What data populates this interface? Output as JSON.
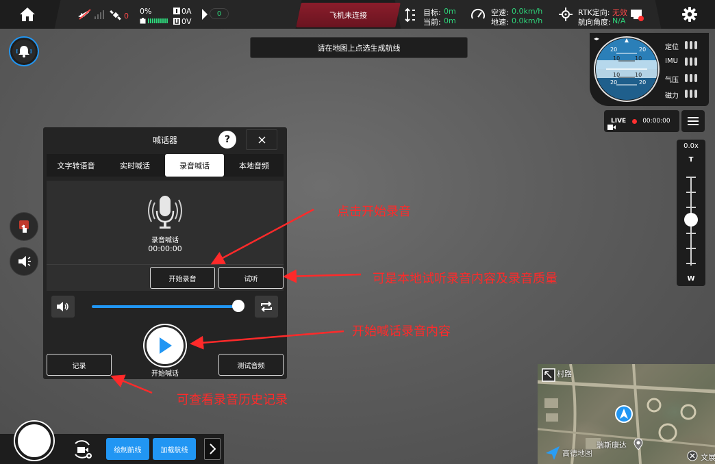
{
  "topbar": {
    "satellite_count": "0",
    "battery_percent": "0%",
    "current_a": "0A",
    "voltage_v": "0V",
    "gear_value": "0",
    "connection_status": "飞机未连接",
    "target_label": "目标:",
    "target_value": "0m",
    "current_label": "当前:",
    "current_value": "0m",
    "airspeed_label": "空速:",
    "airspeed_value": "0.0km/h",
    "groundspeed_label": "地速:",
    "groundspeed_value": "0.0km/h",
    "rtk_label": "RTK定向:",
    "rtk_value": "无效",
    "heading_label": "航向角度:",
    "heading_value": "N/A"
  },
  "notice": "请在地图上点选生成航线",
  "attitude": {
    "scale_top": "20",
    "scale_10": "10",
    "sensors": [
      "定位",
      "IMU",
      "气压",
      "磁力"
    ]
  },
  "live": {
    "badge": "LIVE",
    "timer": "00:00:00"
  },
  "zoom": {
    "value": "0.0x",
    "tele_label": "T",
    "wide_label": "W",
    "level": 0.5
  },
  "dialog": {
    "title": "喊话器",
    "help": "?",
    "tabs": [
      "文字转语音",
      "实时喊话",
      "录音喊话",
      "本地音频"
    ],
    "active_tab": 2,
    "mic_label": "录音喊话",
    "mic_timer": "00:00:00",
    "start_record": "开始录音",
    "listen": "试听",
    "volume_level": 1.0,
    "play_label": "开始喊话",
    "records": "记录",
    "test_audio": "测试音频"
  },
  "annotations": {
    "a1": "点击开始录音",
    "a2": "可是本地试听录音内容及录音质量",
    "a3": "开始喊话录音内容",
    "a4": "可查看录音历史记录"
  },
  "bottombar": {
    "draw_route": "绘制航线",
    "load_route": "加载航线"
  },
  "minimap": {
    "road_label": "村路",
    "place_label": "瑞斯康达",
    "corner_label": "文展",
    "provider_label": "高德地图"
  },
  "colors": {
    "accent_blue": "#2196f3",
    "status_red": "#8a1d2b",
    "annotation_red": "#ff2a2a",
    "ok_green": "#2ed47a"
  }
}
